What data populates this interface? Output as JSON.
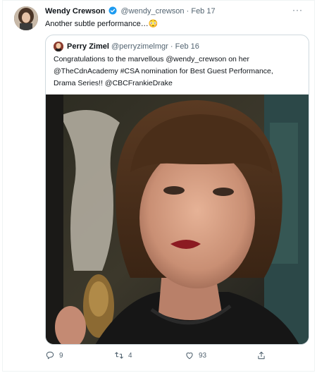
{
  "tweet": {
    "author_name": "Wendy Crewson",
    "author_handle": "@wendy_crewson",
    "separator": "·",
    "date": "Feb 17",
    "text": "Another subtle performance…",
    "emoji": "😳",
    "more_label": "···"
  },
  "quoted": {
    "author_name": "Perry Zimel",
    "author_handle": "@perryzimelmgr",
    "separator": "·",
    "date": "Feb 16",
    "text_line1": "Congratulations to the marvellous @wendy_crewson on her",
    "text_line2": "@TheCdnAcademy #CSA nomination for Best Guest Performance,",
    "text_line3": "Drama Series!!  @CBCFrankieDrake"
  },
  "actions": {
    "replies": "9",
    "retweets": "4",
    "likes": "93"
  },
  "colors": {
    "verified": "#1d9bf0",
    "secondary_text": "#536471",
    "border": "#cfd9de"
  },
  "icons": [
    "verified-badge-icon",
    "more-icon",
    "reply-icon",
    "retweet-icon",
    "like-icon",
    "share-icon"
  ]
}
